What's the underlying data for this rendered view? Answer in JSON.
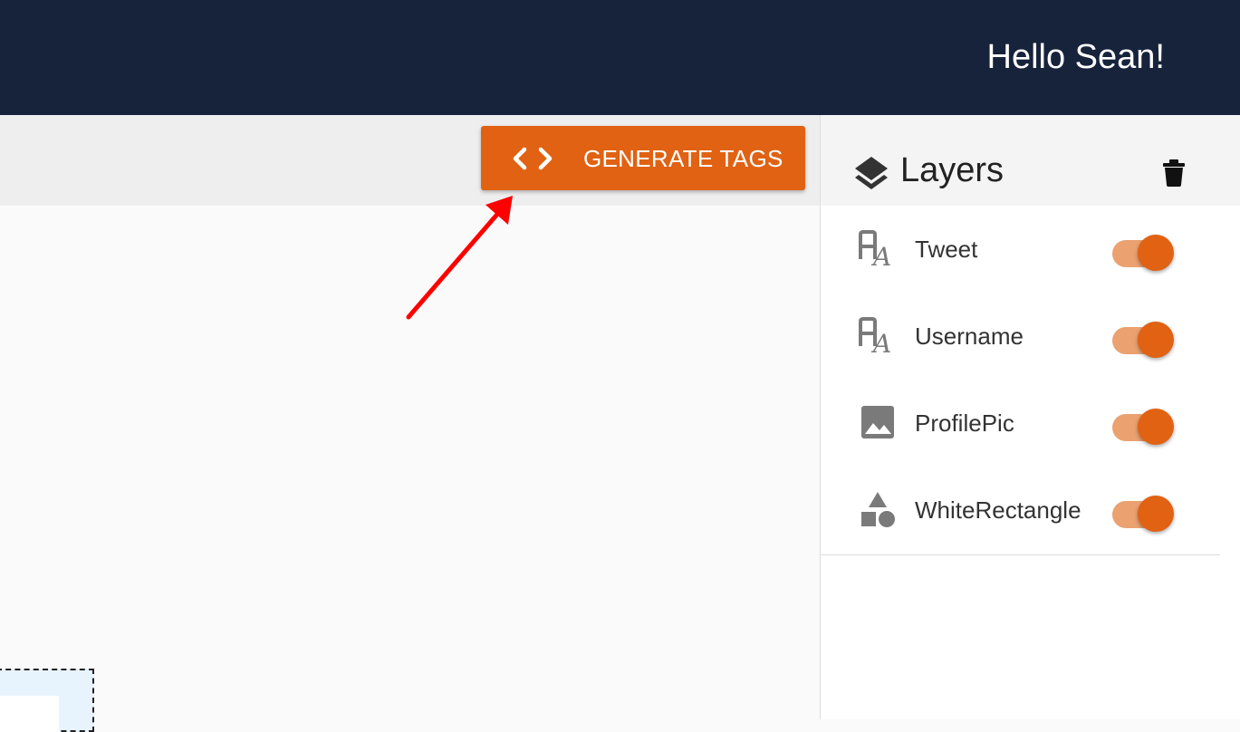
{
  "header": {
    "greeting": "Hello Sean!",
    "background_color": "#16233b"
  },
  "toolbar": {
    "generate_button": {
      "label": "GENERATE TAGS",
      "icon": "code-icon",
      "color": "#e06212"
    }
  },
  "annotation": {
    "arrow_color": "#ff0000",
    "points_to": "generate-tags-button"
  },
  "layers_panel": {
    "title": "Layers",
    "title_icon": "layers-icon",
    "action_icon": "trash-icon",
    "items": [
      {
        "label": "Tweet",
        "icon": "text-fields-icon",
        "visible": true
      },
      {
        "label": "Username",
        "icon": "text-fields-icon",
        "visible": true
      },
      {
        "label": "ProfilePic",
        "icon": "image-icon",
        "visible": true
      },
      {
        "label": "WhiteRectangle",
        "icon": "shapes-icon",
        "visible": true
      }
    ]
  },
  "colors": {
    "accent": "#e06212",
    "toggle_track": "#eba170"
  }
}
